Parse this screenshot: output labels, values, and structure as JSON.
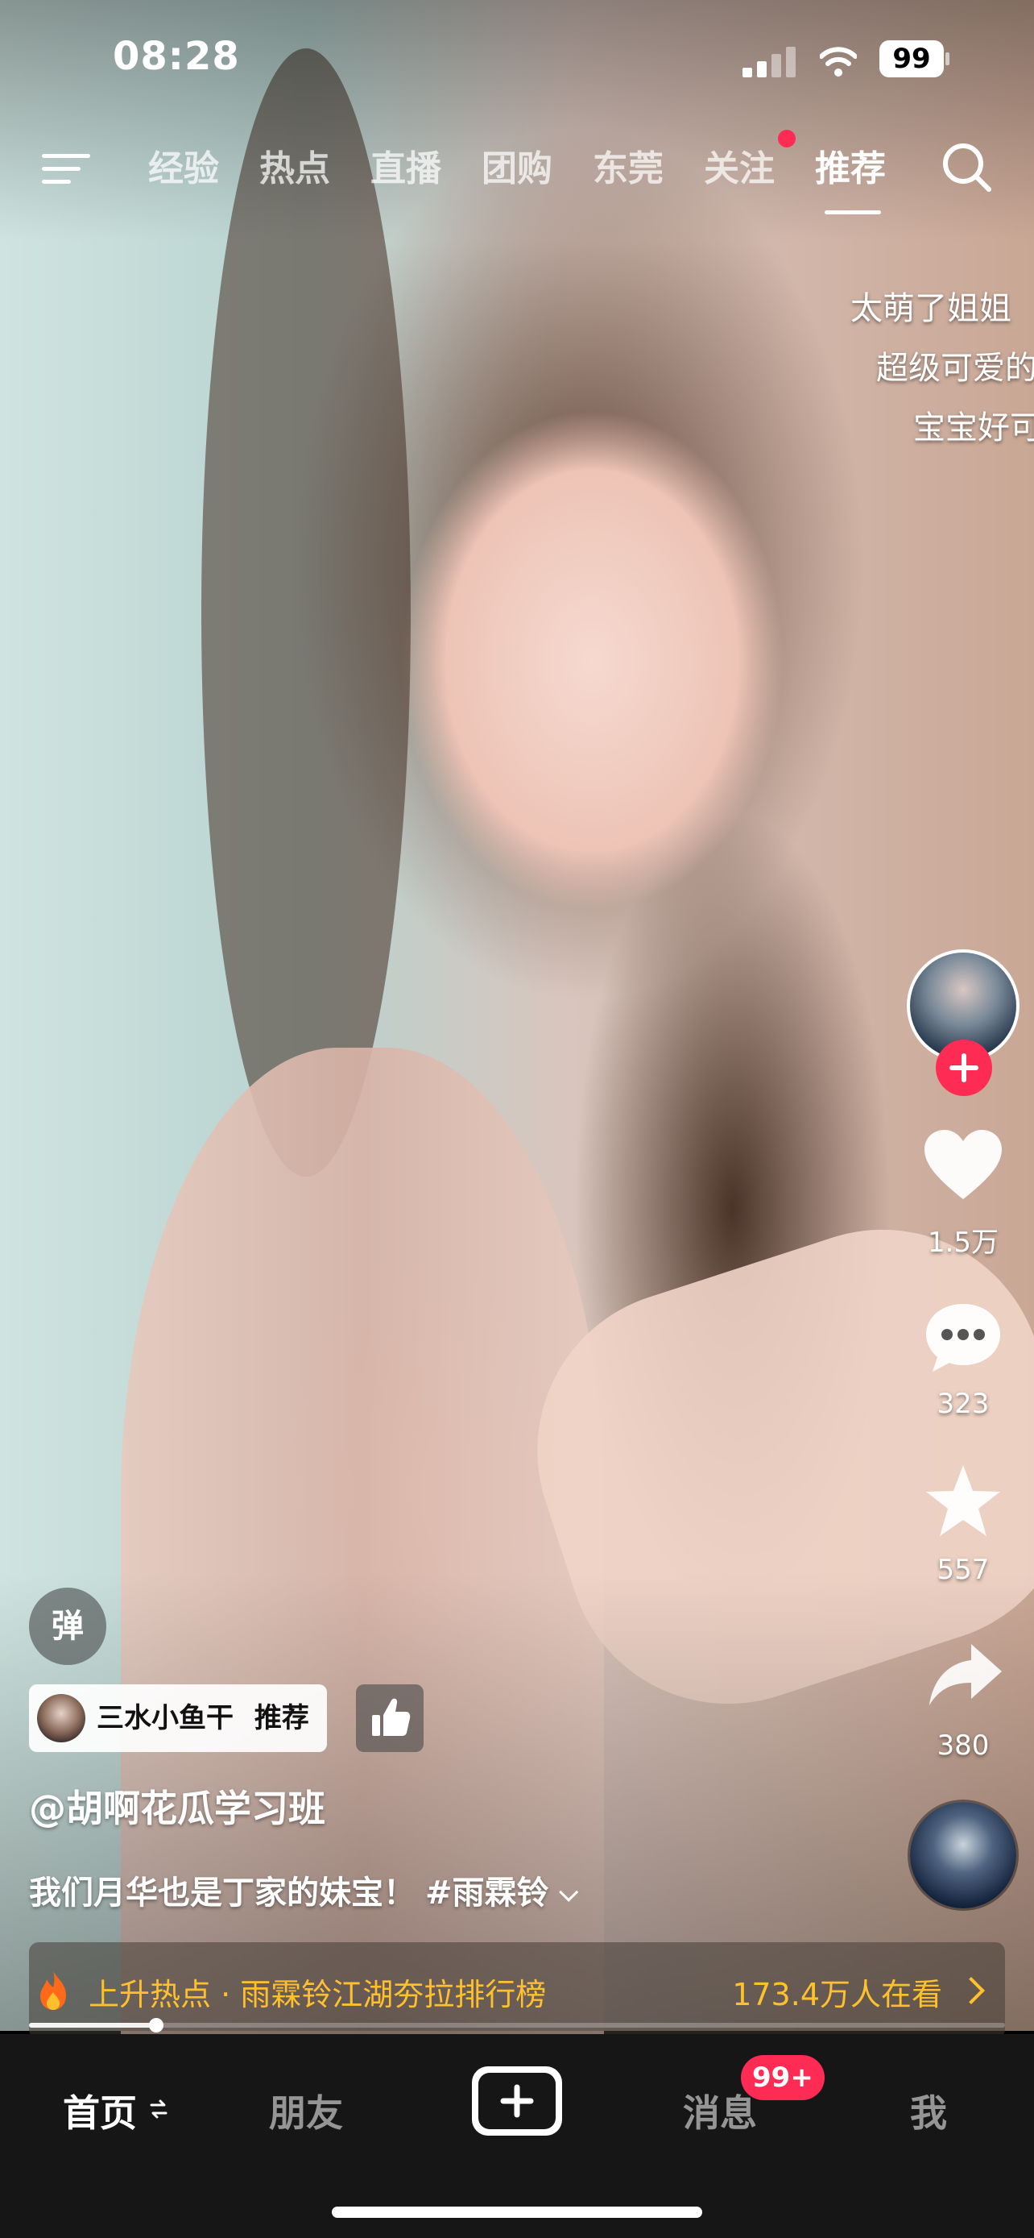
{
  "status_bar": {
    "time": "08:28",
    "battery": "99",
    "signal_icon": "cellular-signal-icon",
    "wifi_icon": "wifi-icon"
  },
  "top_nav": {
    "menu_icon": "hamburger-menu-icon",
    "tabs": [
      {
        "label": "经验"
      },
      {
        "label": "热点"
      },
      {
        "label": "直播"
      },
      {
        "label": "团购"
      },
      {
        "label": "东莞"
      },
      {
        "label": "关注",
        "has_dot": true
      },
      {
        "label": "推荐",
        "active": true
      }
    ],
    "search_icon": "search-icon"
  },
  "danmaku": [
    "太萌了姐姐",
    "超级可爱的",
    "宝宝好可"
  ],
  "actions": {
    "likes": "1.5万",
    "comments": "323",
    "favorites": "557",
    "shares": "380"
  },
  "post": {
    "danmu_toggle": "弹",
    "recommender": "三水小鱼干",
    "recommend_label": "推荐",
    "author": "@胡啊花瓜学习班",
    "caption": "我们月华也是丁家的妹宝！",
    "hashtag": "#雨霖铃",
    "progress": 0.13
  },
  "hot_banner": {
    "title": "上升热点 · 雨霖铃江湖夯拉排行榜",
    "viewers": "173.4万人在看"
  },
  "tab_bar": {
    "home": "首页",
    "friends": "朋友",
    "messages": "消息",
    "messages_badge": "99+",
    "me": "我"
  },
  "colors": {
    "accent": "#fe2c55",
    "hot": "#ffc02e",
    "tab_bar_bg": "#161616"
  }
}
